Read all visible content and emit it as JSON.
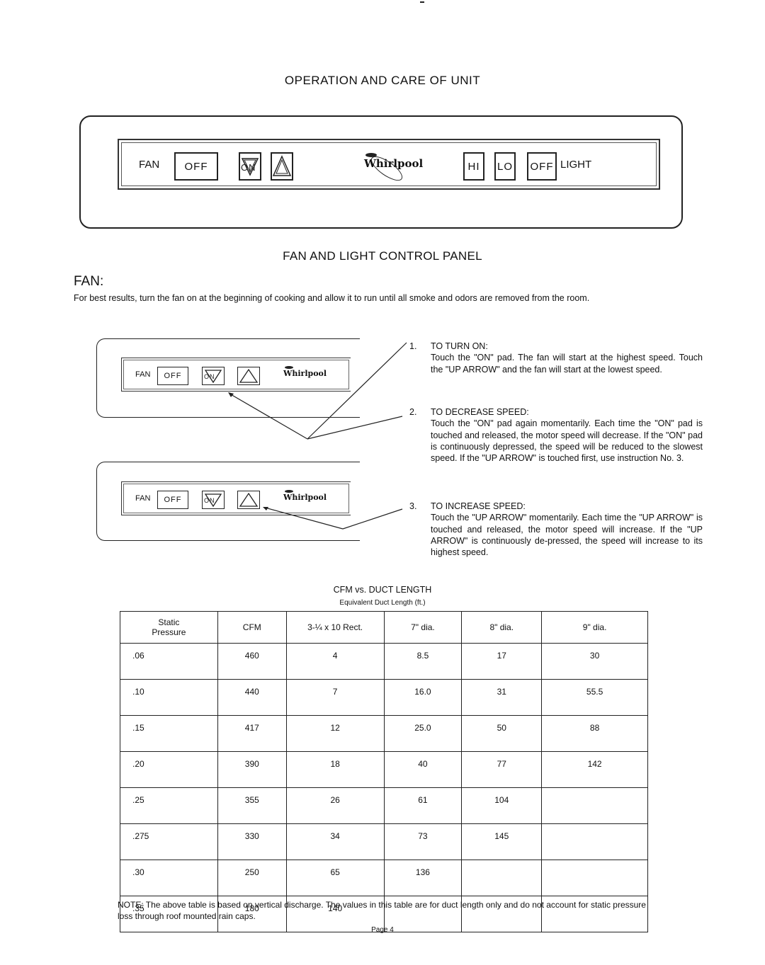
{
  "page": {
    "title": "OPERATION AND CARE OF UNIT",
    "panel_caption": "FAN AND LIGHT CONTROL PANEL",
    "section_heading": "FAN:",
    "intro": "For best results, turn the fan on at the beginning of cooking and allow it to run until all smoke and odors are removed from the room.",
    "page_number": "Page 4"
  },
  "control_panel": {
    "fan_label": "FAN",
    "fan_off": "OFF",
    "on_pad": "ON",
    "up_arrow_icon": "up-arrow-triangle",
    "brand": "Whirlpool",
    "light_hi": "HI",
    "light_lo": "LO",
    "light_off": "OFF",
    "light_label": "LIGHT"
  },
  "mini_panel": {
    "fan_label": "FAN",
    "fan_off": "OFF",
    "on_pad": "ON",
    "brand": "Whirlpool"
  },
  "instructions": [
    {
      "num": "1.",
      "title": "TO TURN ON:",
      "text": "Touch the \"ON\" pad. The fan will start at the highest speed. Touch the \"UP ARROW\" and the fan will start at the lowest speed."
    },
    {
      "num": "2.",
      "title": "TO DECREASE SPEED:",
      "text": "Touch the \"ON\" pad again momentarily. Each time the \"ON\" pad is touched and released, the motor speed will decrease. If the \"ON\" pad is continuously depressed, the speed will be reduced to the slowest speed. If the \"UP ARROW\" is touched first, use instruction No. 3."
    },
    {
      "num": "3.",
      "title": "TO INCREASE SPEED:",
      "text": "Touch the \"UP ARROW\" momentarily. Each time the \"UP ARROW\" is touched and released, the motor speed will increase. If the \"UP ARROW\" is continuously de-pressed, the speed will increase to its highest speed."
    }
  ],
  "table": {
    "title": "CFM vs. DUCT LENGTH",
    "subtitle": "Equivalent Duct Length (ft.)",
    "headers": [
      "Static\nPressure",
      "CFM",
      "3-¼ x 10 Rect.",
      "7\" dia.",
      "8\" dia.",
      "9\" dia."
    ],
    "rows": [
      [
        ".06",
        "460",
        "4",
        "8.5",
        "17",
        "30"
      ],
      [
        ".10",
        "440",
        "7",
        "16.0",
        "31",
        "55.5"
      ],
      [
        ".15",
        "417",
        "12",
        "25.0",
        "50",
        "88"
      ],
      [
        ".20",
        "390",
        "18",
        "40",
        "77",
        "142"
      ],
      [
        ".25",
        "355",
        "26",
        "61",
        "104",
        ""
      ],
      [
        ".275",
        "330",
        "34",
        "73",
        "145",
        ""
      ],
      [
        ".30",
        "250",
        "65",
        "136",
        "",
        ""
      ],
      [
        ".35",
        "180",
        "140",
        "",
        "",
        ""
      ]
    ]
  },
  "note": "NOTE: The above table is based on vertical discharge. The values in this table are for duct length only and do not account for static pressure loss through roof mounted rain caps."
}
